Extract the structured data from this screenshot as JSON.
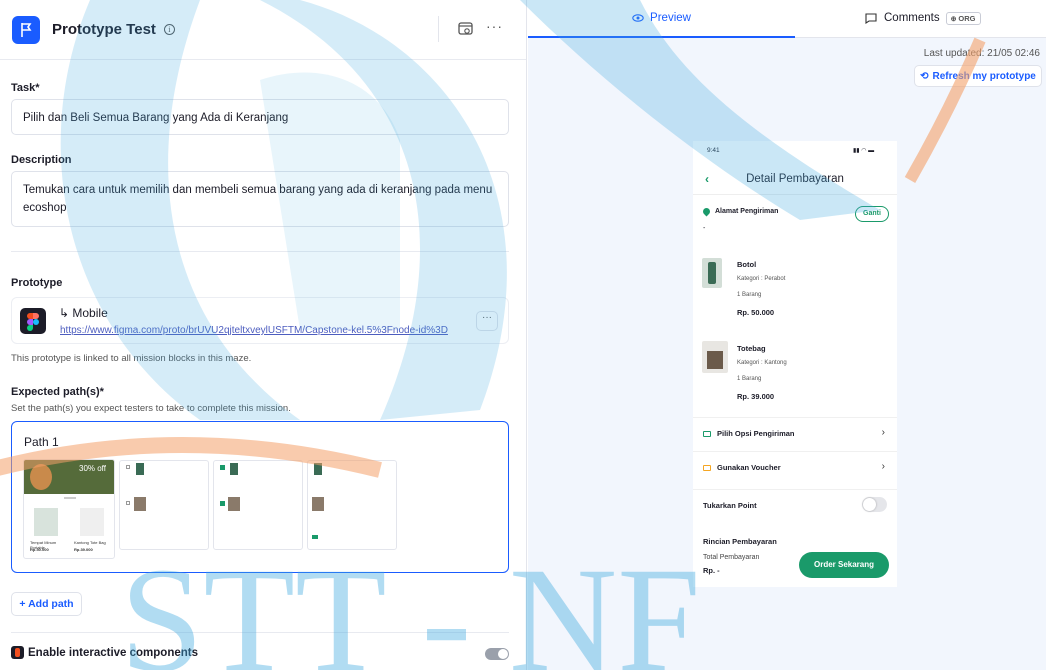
{
  "header": {
    "title": "Prototype Test",
    "info_icon": "info-icon",
    "edit_icon": "window-edit-icon",
    "more_icon": "more-icon",
    "more_label": "···"
  },
  "task": {
    "label": "Task*",
    "value": "Pilih dan Beli Semua Barang yang Ada di Keranjang"
  },
  "description": {
    "label": "Description",
    "value": "Temukan cara untuk memilih dan membeli semua barang yang ada di keranjang pada menu ecoshop"
  },
  "prototype": {
    "label": "Prototype",
    "name": "↳ Mobile",
    "url": "https://www.figma.com/proto/brUVU2qjteltxveylUSFTM/Capstone-kel.5%3Fnode-id%3D",
    "more_label": "···",
    "note": "This prototype is linked to all mission blocks in this maze."
  },
  "expected_paths": {
    "label": "Expected path(s)*",
    "hint": "Set the path(s) you expect testers to take to complete this mission.",
    "path_title": "Path 1",
    "add_label": "+ Add path"
  },
  "interactive": {
    "label": "Enable interactive components"
  },
  "preview": {
    "tab_preview": "Preview",
    "tab_comments": "Comments",
    "org_badge": "ORG",
    "last_updated": "Last updated: 21/05 02:46",
    "refresh": "Refresh my prototype"
  },
  "phone": {
    "time": "9:41",
    "title": "Detail Pembayaran",
    "address_label": "Alamat Pengiriman",
    "ganti": "Ganti",
    "dash": "-",
    "items": [
      {
        "name": "Botol",
        "category": "Kategori : Perabot",
        "qty": "1 Barang",
        "price": "Rp. 50.000"
      },
      {
        "name": "Totebag",
        "category": "Kategori : Kantong",
        "qty": "1 Barang",
        "price": "Rp. 39.000"
      }
    ],
    "shipping": "Pilih Opsi Pengiriman",
    "voucher": "Gunakan Voucher",
    "points": "Tukarkan Point",
    "summary": "Rincian Pembayaran",
    "total_label": "Total Pembayaran",
    "total_value": "Rp. -",
    "order_button": "Order Sekarang"
  },
  "thumbnails": {
    "discount": "30% off",
    "product1": "Tempat Minum Portable",
    "product1_price": "Rp.50.000",
    "product2": "Kantong Tote Bag",
    "product2_price": "Rp.39.000"
  },
  "watermark": {
    "text": "STT - NF"
  },
  "colors": {
    "accent": "#1a5cff",
    "green": "#1a9a6a",
    "watermark_blue": "#3fa9df",
    "watermark_orange": "#f4a16a"
  }
}
